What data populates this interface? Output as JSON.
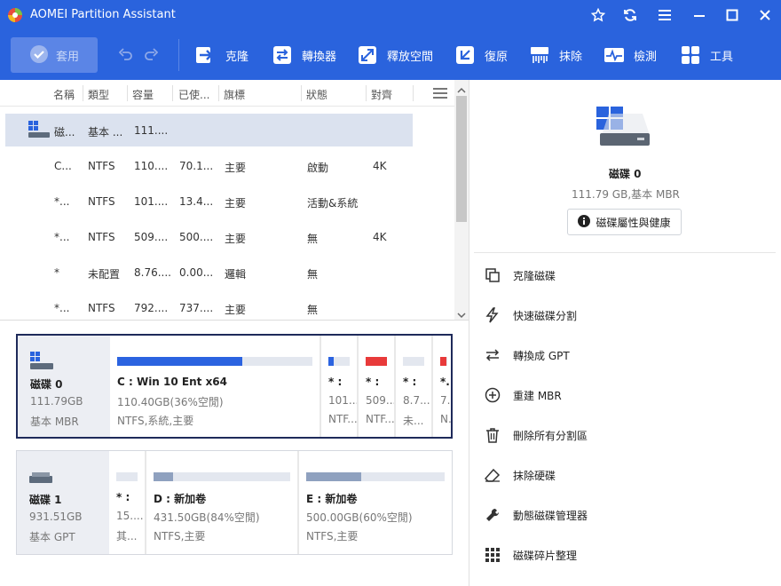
{
  "window": {
    "title": "AOMEI Partition Assistant"
  },
  "toolbar": {
    "apply": "套用",
    "clone": "克隆",
    "convert": "轉換器",
    "free_space": "釋放空間",
    "restore": "復原",
    "wipe": "抹除",
    "check": "檢測",
    "tools": "工具"
  },
  "table": {
    "headers": [
      "名稱",
      "類型",
      "容量",
      "已使...",
      "旗標",
      "狀態",
      "對齊"
    ],
    "disk_row": {
      "name": "磁...",
      "type": "基本 ...",
      "capacity": "111...."
    },
    "rows": [
      {
        "name": "C...",
        "type": "NTFS",
        "capacity": "110....",
        "used": "70.1...",
        "flag": "主要",
        "status": "啟動",
        "align": "4K"
      },
      {
        "name": "*...",
        "type": "NTFS",
        "capacity": "101....",
        "used": "13.4...",
        "flag": "主要",
        "status": "活動&系統",
        "align": ""
      },
      {
        "name": "*...",
        "type": "NTFS",
        "capacity": "509....",
        "used": "500....",
        "flag": "主要",
        "status": "無",
        "align": "4K"
      },
      {
        "name": "*",
        "type": "未配置",
        "capacity": "8.76....",
        "used": "0.00...",
        "flag": "邏輯",
        "status": "無",
        "align": ""
      },
      {
        "name": "*...",
        "type": "NTFS",
        "capacity": "792....",
        "used": "737....",
        "flag": "主要",
        "status": "無",
        "align": ""
      }
    ]
  },
  "disk0": {
    "name": "磁碟 0",
    "size": "111.79GB",
    "type": "基本 MBR",
    "partitions": [
      {
        "label": "C : Win 10 Ent x64",
        "size": "110.40GB(36%空閒)",
        "fs": "NTFS,系統,主要",
        "used_fraction": 0.64,
        "color": "#2b63e0"
      },
      {
        "label": "* :",
        "size": "101...",
        "fs": "NTF...",
        "used_fraction": 0.13,
        "color": "#2b63e0"
      },
      {
        "label": "* :",
        "size": "509...",
        "fs": "NTF...",
        "used_fraction": 0.98,
        "color": "#e83a3a"
      },
      {
        "label": "* :",
        "size": "8.7...",
        "fs": "未...",
        "used_fraction": 0,
        "color": "#c8d0de"
      },
      {
        "label": "*...",
        "size": "7...",
        "fs": "N...",
        "used_fraction": 0.93,
        "color": "#e83a3a"
      }
    ]
  },
  "disk1": {
    "name": "磁碟 1",
    "size": "931.51GB",
    "type": "基本 GPT",
    "partitions": [
      {
        "label": "* :",
        "size": "15....",
        "fs": "其...",
        "used_fraction": 0,
        "color": "#c8d0de"
      },
      {
        "label": "D : 新加卷",
        "size": "431.50GB(84%空閒)",
        "fs": "NTFS,主要",
        "used_fraction": 0.14,
        "color": "#8fa1bf"
      },
      {
        "label": "E : 新加卷",
        "size": "500.00GB(60%空閒)",
        "fs": "NTFS,主要",
        "used_fraction": 0.4,
        "color": "#8fa1bf"
      }
    ]
  },
  "right": {
    "disk_name": "磁碟 0",
    "disk_info": "111.79 GB,基本 MBR",
    "props_button": "磁碟屬性與健康",
    "ops": [
      "克隆磁碟",
      "快速磁碟分割",
      "轉換成 GPT",
      "重建 MBR",
      "刪除所有分割區",
      "抹除硬碟",
      "動態磁碟管理器",
      "磁碟碎片整理"
    ]
  },
  "colors": {
    "accent": "#2a63dd",
    "selected_row": "#dbe2ef",
    "used_red": "#e83a3a",
    "used_blue": "#2b63e0"
  }
}
